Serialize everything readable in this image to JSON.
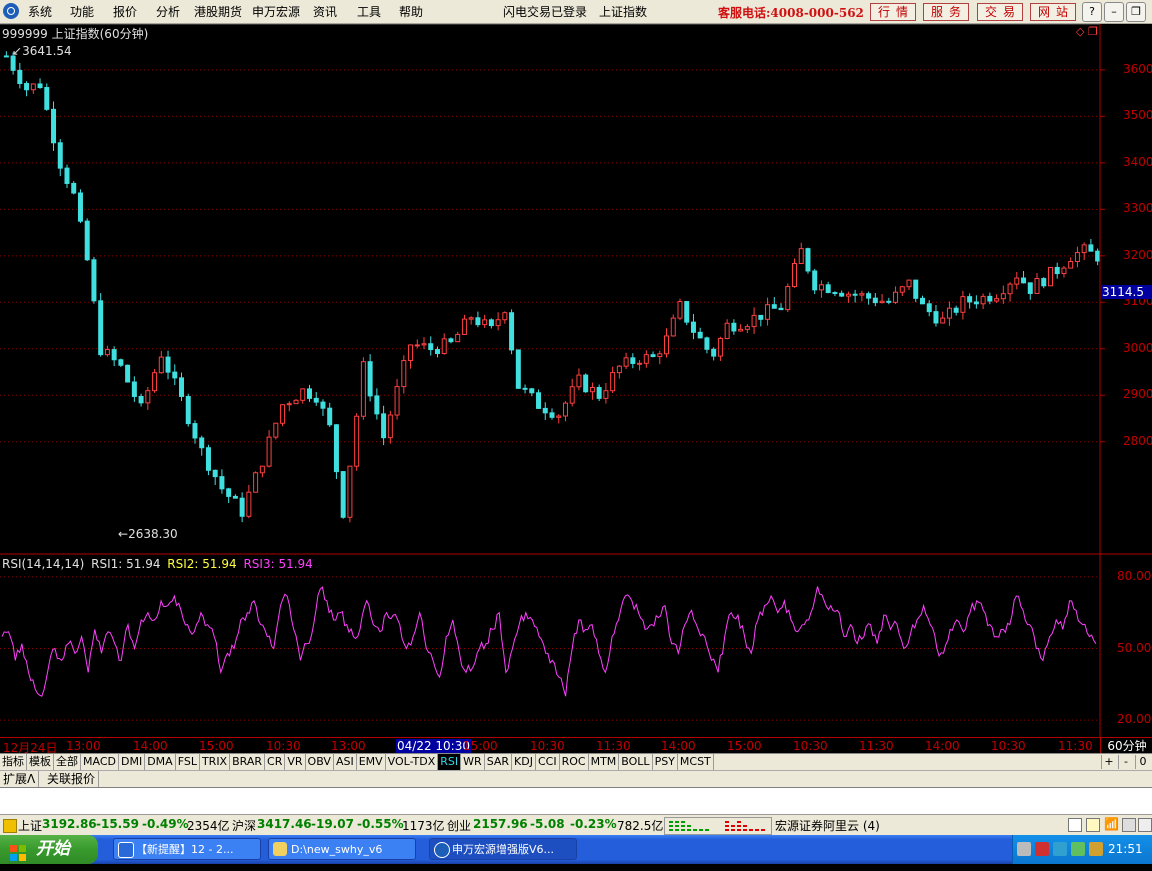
{
  "menu": {
    "items": [
      "系统",
      "功能",
      "报价",
      "分析",
      "港股期货",
      "申万宏源",
      "资讯",
      "工具",
      "帮助"
    ],
    "login_status": "闪电交易已登录",
    "current_index": "上证指数",
    "hotline": "客服电话:4008-000-562",
    "tabs": [
      "行情",
      "服务",
      "交易",
      "网站"
    ]
  },
  "window_controls": {
    "help": "?",
    "minimize": "–",
    "restore": "❐",
    "close": "✕"
  },
  "chart": {
    "title": "999999 上证指数(60分钟)",
    "high_label": "3641.54",
    "low_label": "2638.30",
    "current_price_label": "3114.5",
    "price_axis": [
      "3600",
      "3500",
      "3400",
      "3300",
      "3200",
      "3100",
      "3000",
      "2900",
      "2800"
    ],
    "colors": {
      "up": "#ff4040",
      "down": "#40e0e0",
      "grid": "#8b0000",
      "axis": "#b00000",
      "rsi": "#ff40ff",
      "rsi2": "#ffff40"
    }
  },
  "chart_data": [
    {
      "type": "candlestick",
      "title": "999999 上证指数(60分钟)",
      "ylim": [
        2580,
        3660
      ],
      "y_ticks": [
        3600,
        3500,
        3400,
        3300,
        3200,
        3100,
        3000,
        2900,
        2800
      ],
      "path_points": [
        [
          0,
          3630
        ],
        [
          3,
          3560
        ],
        [
          5,
          3570
        ],
        [
          8,
          3400
        ],
        [
          10,
          3330
        ],
        [
          12,
          3190
        ],
        [
          14,
          3000
        ],
        [
          17,
          2960
        ],
        [
          20,
          2870
        ],
        [
          23,
          2990
        ],
        [
          26,
          2890
        ],
        [
          29,
          2780
        ],
        [
          32,
          2700
        ],
        [
          35,
          2650
        ],
        [
          38,
          2760
        ],
        [
          41,
          2880
        ],
        [
          44,
          2910
        ],
        [
          46,
          2900
        ],
        [
          48,
          2830
        ],
        [
          50,
          2650
        ],
        [
          53,
          2960
        ],
        [
          56,
          2810
        ],
        [
          58,
          2910
        ],
        [
          60,
          3010
        ],
        [
          63,
          3000
        ],
        [
          66,
          3010
        ],
        [
          69,
          3070
        ],
        [
          72,
          3040
        ],
        [
          74,
          3090
        ],
        [
          76,
          2920
        ],
        [
          79,
          2880
        ],
        [
          82,
          2860
        ],
        [
          85,
          2930
        ],
        [
          88,
          2900
        ],
        [
          91,
          2960
        ],
        [
          94,
          2980
        ],
        [
          96,
          2980
        ],
        [
          98,
          3020
        ],
        [
          100,
          3090
        ],
        [
          102,
          3040
        ],
        [
          104,
          3000
        ],
        [
          105,
          2990
        ],
        [
          107,
          3050
        ],
        [
          110,
          3060
        ],
        [
          113,
          3080
        ],
        [
          115,
          3090
        ],
        [
          118,
          3210
        ],
        [
          120,
          3140
        ],
        [
          123,
          3130
        ],
        [
          125,
          3120
        ],
        [
          128,
          3110
        ],
        [
          131,
          3100
        ],
        [
          134,
          3140
        ],
        [
          136,
          3090
        ],
        [
          139,
          3060
        ],
        [
          142,
          3100
        ],
        [
          145,
          3110
        ],
        [
          147,
          3120
        ],
        [
          150,
          3160
        ],
        [
          152,
          3130
        ],
        [
          154,
          3150
        ],
        [
          156,
          3170
        ],
        [
          158,
          3200
        ],
        [
          160,
          3210
        ],
        [
          162,
          3200
        ]
      ],
      "high": 3641.54,
      "low": 2638.3,
      "last": 3114.5,
      "x_ticks": [
        "12月24日",
        "13:00",
        "14:00",
        "15:00",
        "10:30",
        "13:00",
        "04/22 10:30",
        "15:00",
        "10:30",
        "11:30",
        "14:00",
        "15:00",
        "10:30",
        "11:30",
        "14:00",
        "10:30",
        "11:30"
      ]
    },
    {
      "type": "line",
      "title": "RSI(14,14,14)",
      "ylim": [
        15,
        85
      ],
      "y_ticks": [
        80,
        50,
        20
      ],
      "series": [
        {
          "name": "RSI1",
          "last": 51.94
        },
        {
          "name": "RSI2",
          "last": 51.94
        },
        {
          "name": "RSI3",
          "last": 51.94,
          "values": [
            55,
            57,
            45,
            52,
            40,
            33,
            30,
            42,
            50,
            45,
            52,
            48,
            55,
            40,
            58,
            48,
            57,
            52,
            45,
            60,
            50,
            62,
            65,
            62,
            70,
            68,
            72,
            66,
            60,
            57,
            65,
            60,
            55,
            40,
            48,
            50,
            62,
            65,
            70,
            60,
            55,
            50,
            68,
            72,
            58,
            45,
            52,
            60,
            75,
            70,
            62,
            65,
            60,
            55,
            58,
            70,
            60,
            57,
            65,
            64,
            60,
            50,
            55,
            65,
            50,
            45,
            38,
            55,
            62,
            48,
            40,
            42,
            50,
            52,
            58,
            65,
            40,
            50,
            60,
            65,
            62,
            55,
            48,
            45,
            38,
            30,
            50,
            62,
            58,
            60,
            48,
            40,
            55,
            62,
            72,
            70,
            65,
            58,
            60,
            63,
            68,
            52,
            48,
            60,
            66,
            58,
            55,
            45,
            40,
            55,
            65,
            64,
            55,
            48,
            62,
            68,
            72,
            65,
            70,
            62,
            57,
            60,
            65,
            76,
            70,
            68,
            66,
            55,
            60,
            52,
            55,
            60,
            52,
            64,
            58,
            60,
            50,
            56,
            62,
            68,
            60,
            50,
            48,
            58,
            62,
            57,
            65,
            70,
            66,
            60,
            55,
            58,
            60,
            72,
            66,
            60,
            50,
            45,
            55,
            62,
            58,
            70,
            66,
            60,
            55,
            52
          ]
        }
      ]
    }
  ],
  "rsi_header": {
    "label": "RSI(14,14,14)",
    "rsi1": "RSI1: 51.94",
    "rsi2": "RSI2: 51.94",
    "rsi3": "RSI3: 51.94"
  },
  "rsi_axis": [
    "80.00",
    "50.00",
    "20.00"
  ],
  "time_axis": [
    {
      "label": "12月24日",
      "x": 3
    },
    {
      "label": "13:00",
      "x": 66
    },
    {
      "label": "14:00",
      "x": 133
    },
    {
      "label": "15:00",
      "x": 199
    },
    {
      "label": "10:30",
      "x": 266
    },
    {
      "label": "13:00",
      "x": 331
    },
    {
      "label": "04/22 10:30",
      "x": 396,
      "cursor": true
    },
    {
      "label": "15:00",
      "x": 463
    },
    {
      "label": "10:30",
      "x": 530
    },
    {
      "label": "11:30",
      "x": 596
    },
    {
      "label": "14:00",
      "x": 661
    },
    {
      "label": "15:00",
      "x": 727
    },
    {
      "label": "10:30",
      "x": 793
    },
    {
      "label": "11:30",
      "x": 859
    },
    {
      "label": "14:00",
      "x": 925
    },
    {
      "label": "10:30",
      "x": 991
    },
    {
      "label": "11:30",
      "x": 1058
    }
  ],
  "period": "60分钟",
  "indicator_tabs": [
    "指标",
    "模板",
    "全部",
    "MACD",
    "DMI",
    "DMA",
    "FSL",
    "TRIX",
    "BRAR",
    "CR",
    "VR",
    "OBV",
    "ASI",
    "EMV",
    "VOL-TDX",
    "RSI",
    "WR",
    "SAR",
    "KDJ",
    "CCI",
    "ROC",
    "MTM",
    "BOLL",
    "PSY",
    "MCST"
  ],
  "active_indicator": "RSI",
  "zoom": {
    "plus": "+",
    "minus": "-",
    "zero": "0"
  },
  "extra_tabs": [
    "扩展Λ",
    "关联报价"
  ],
  "status": {
    "sh_label": "上证",
    "sh_price": "3192.86",
    "sh_change": "-15.59",
    "sh_pct": "-0.49%",
    "sh_amount": "2354亿",
    "hs_label": "沪深",
    "hs_price": "3417.46",
    "hs_change": "-19.07",
    "hs_pct": "-0.55%",
    "hs_amount": "1173亿",
    "cy_label": "创业",
    "cy_price": "2157.96",
    "cy_change": "-5.08",
    "cy_pct": "-0.23%",
    "cy_amount": "782.5亿",
    "server": "宏源证券阿里云 (4)"
  },
  "taskbar": {
    "start": "开始",
    "tasks": [
      "【新提醒】12 - 2...",
      "D:\\new_swhy_v6",
      "申万宏源增强版V6..."
    ],
    "clock": "21:51"
  }
}
